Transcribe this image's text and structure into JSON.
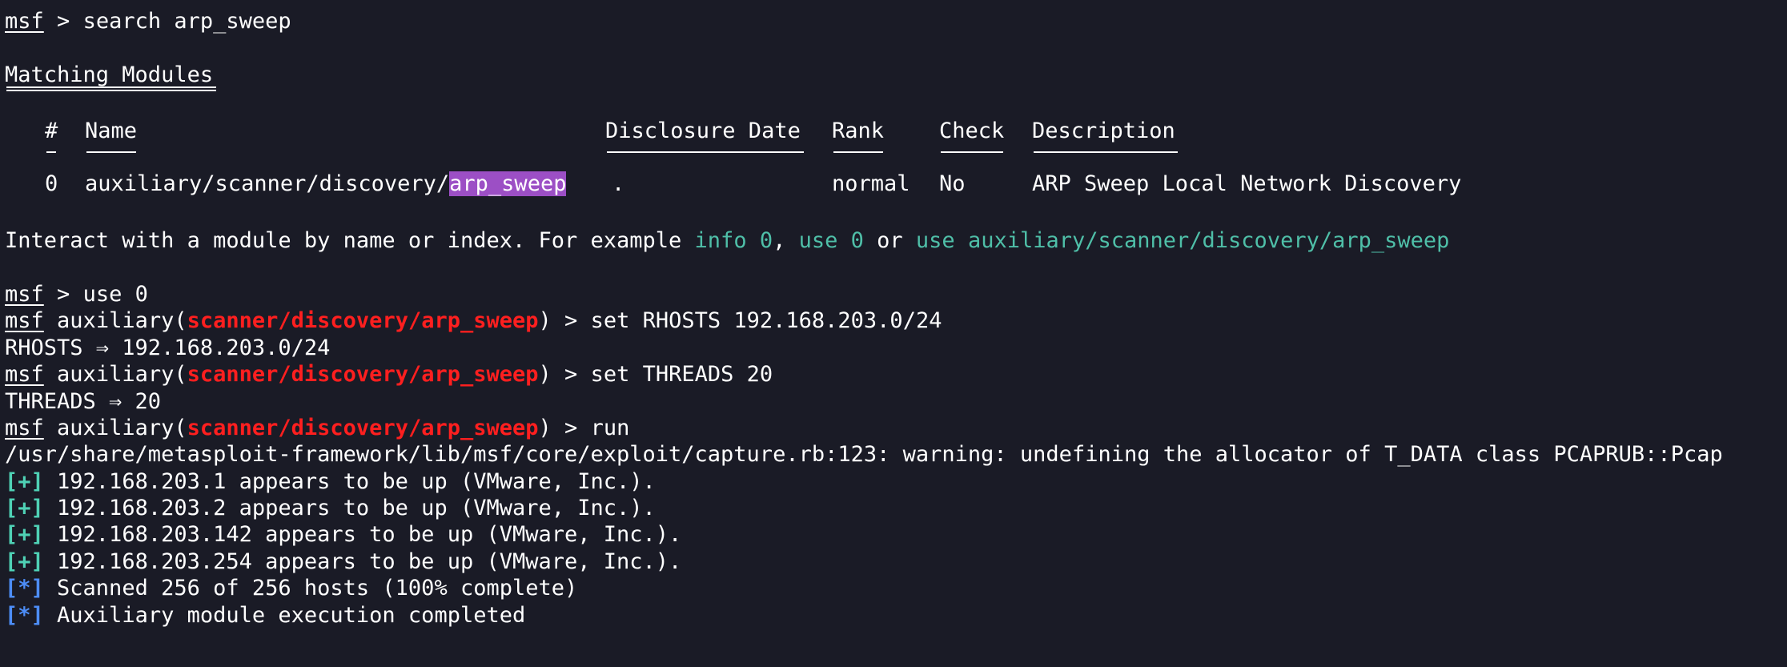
{
  "prompt": {
    "name": "msf",
    "sep": " > "
  },
  "commands": {
    "search": "search arp_sweep",
    "use": "use 0",
    "module_prefix": "auxiliary(",
    "module_path": "scanner/discovery/arp_sweep",
    "module_suffix": ")",
    "set_rhosts": "set RHOSTS 192.168.203.0/24",
    "set_threads": "set THREADS 20",
    "run": "run"
  },
  "matching_modules": {
    "heading": "Matching Modules",
    "columns": {
      "index": "#",
      "name": "Name",
      "disclosure_date": "Disclosure Date",
      "rank": "Rank",
      "check": "Check",
      "description": "Description"
    },
    "rows": [
      {
        "index": "0",
        "name_prefix": "auxiliary/scanner/discovery/",
        "name_match": "arp_sweep",
        "disclosure_date": ".",
        "rank": "normal",
        "check": "No",
        "description": "ARP Sweep Local Network Discovery"
      }
    ]
  },
  "interact_hint": {
    "text": "Interact with a module by name or index. For example ",
    "ex1": "info 0",
    "comma": ", ",
    "ex2": "use 0",
    "or": " or ",
    "ex3": "use auxiliary/scanner/discovery/arp_sweep"
  },
  "outputs": {
    "rhosts": "RHOSTS ⇒ 192.168.203.0/24",
    "threads": "THREADS ⇒ 20",
    "warning": "/usr/share/metasploit-framework/lib/msf/core/exploit/capture.rb:123: warning: undefining the allocator of T_DATA class PCAPRUB::Pcap"
  },
  "results": [
    {
      "marker": "[+]",
      "text": " 192.168.203.1 appears to be up (VMware, Inc.)."
    },
    {
      "marker": "[+]",
      "text": " 192.168.203.2 appears to be up (VMware, Inc.)."
    },
    {
      "marker": "[+]",
      "text": " 192.168.203.142 appears to be up (VMware, Inc.)."
    },
    {
      "marker": "[+]",
      "text": " 192.168.203.254 appears to be up (VMware, Inc.)."
    }
  ],
  "status": [
    {
      "marker": "[*]",
      "text": " Scanned 256 of 256 hosts (100% complete)"
    },
    {
      "marker": "[*]",
      "text": " Auxiliary module execution completed"
    }
  ],
  "colors": {
    "background": "#1a1b26",
    "text": "#ffffff",
    "module_red": "#ff1f1f",
    "hint_teal": "#4fbfa8",
    "good_marker": "#4fd1b5",
    "info_marker": "#4d8df7",
    "match_highlight": "#9c4fc5"
  }
}
